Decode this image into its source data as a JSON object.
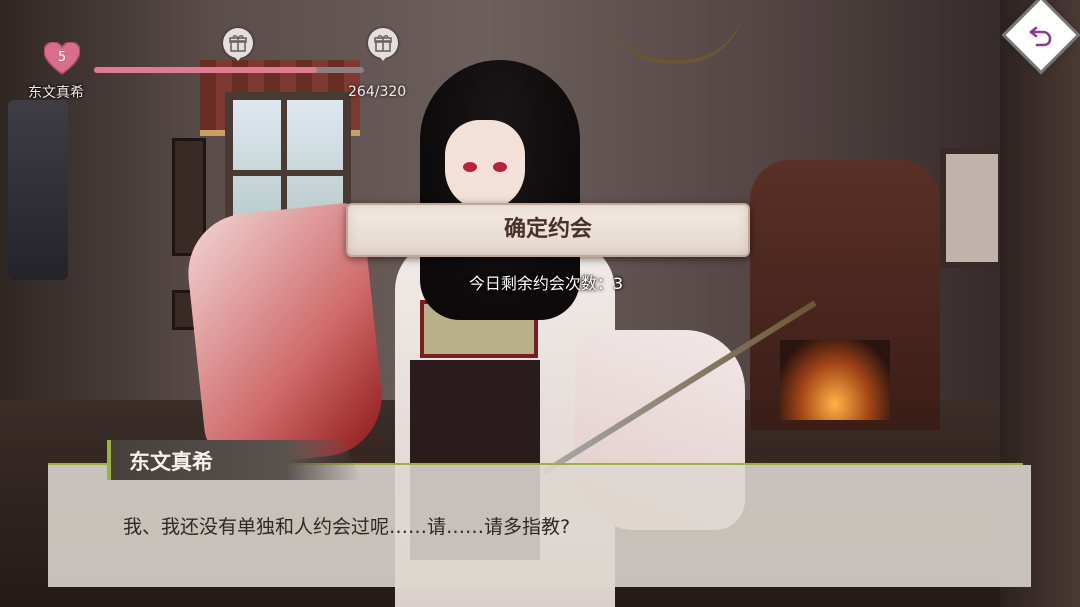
{
  "hud": {
    "affection_level": "5",
    "character_name": "东文真希",
    "affection_progress_text": "264/320",
    "affection_progress_fraction": 0.825,
    "icons": [
      "heart-icon",
      "gift-icon",
      "gift-icon"
    ],
    "bar_color": "#e07b95"
  },
  "back_button": {
    "icon": "return-arrow-icon"
  },
  "confirm": {
    "button_label": "确定约会",
    "remaining_text": "今日剩余约会次数：3"
  },
  "dialogue": {
    "speaker": "东文真希",
    "line": "我、我还没有单独和人约会过呢……请……请多指教?",
    "accent_color": "#9bb23b"
  }
}
